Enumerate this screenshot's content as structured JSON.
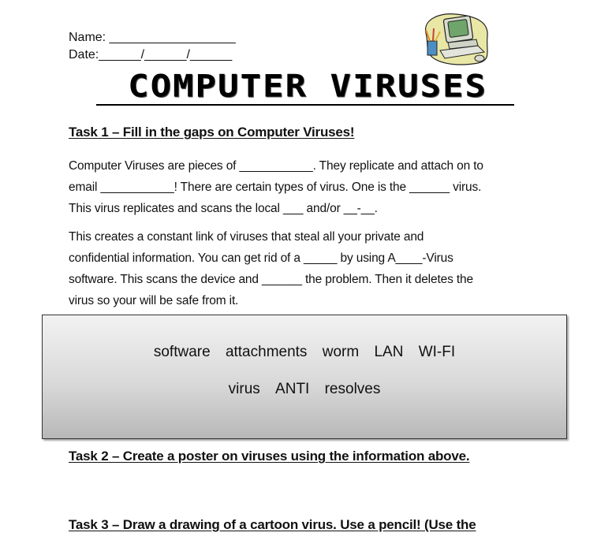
{
  "header": {
    "name_label": "Name: __________________",
    "date_label": "Date:______/______/______"
  },
  "clipart": {
    "icon": "computer-clipart-icon",
    "description": "computer with pencil cup"
  },
  "title": "COMPUTER VIRUSES",
  "task1": {
    "heading": "Task 1 – Fill in the gaps on Computer Viruses!",
    "paragraph1": [
      "Computer Viruses are pieces of ___________. They replicate and attach on to",
      "email ___________! There are certain types of virus. One is the ______ virus.",
      "This virus replicates and scans the local ___ and/or __-__."
    ],
    "paragraph2": [
      "This creates a constant link of viruses that steal all your private and",
      "confidential information. You can get rid of a _____ by using A____-Virus",
      "software. This scans the device and ______ the problem. Then it deletes the",
      "virus so your will be safe from it."
    ]
  },
  "word_bank": {
    "row1": [
      "software",
      "attachments",
      "worm",
      "LAN",
      "WI-FI"
    ],
    "row2": [
      "virus",
      "ANTI",
      "resolves"
    ]
  },
  "task2": {
    "heading": "Task 2 – Create a poster on viruses using the information above."
  },
  "task3": {
    "heading": "Task 3 – Draw a drawing of a cartoon virus. Use a pencil! (Use the"
  }
}
